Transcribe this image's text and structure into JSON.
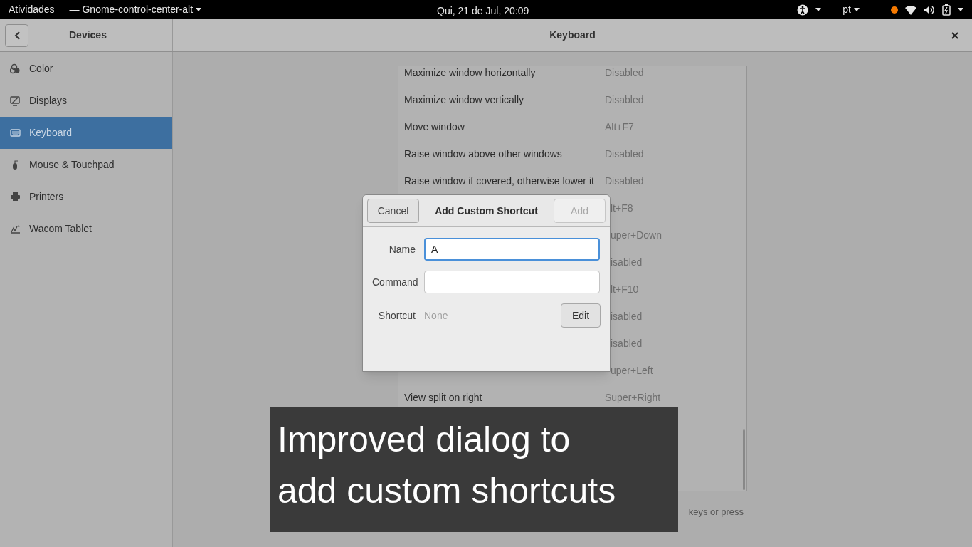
{
  "top_bar": {
    "activities": "Atividades",
    "app_menu": "— Gnome-control-center-alt",
    "clock": "Qui, 21 de Jul, 20:09",
    "language": "pt",
    "notification_dot": {
      "color": "#f57900"
    }
  },
  "sidebar": {
    "title": "Devices",
    "items": [
      {
        "label": "Color",
        "kind": "color",
        "selected": false
      },
      {
        "label": "Displays",
        "kind": "display",
        "selected": false
      },
      {
        "label": "Keyboard",
        "kind": "keyboard",
        "selected": true
      },
      {
        "label": "Mouse & Touchpad",
        "kind": "mouse",
        "selected": false
      },
      {
        "label": "Printers",
        "kind": "printer",
        "selected": false
      },
      {
        "label": "Wacom Tablet",
        "kind": "tablet",
        "selected": false
      }
    ]
  },
  "panel": {
    "title": "Keyboard",
    "shortcuts": [
      {
        "name": "Maximize window horizontally",
        "shortcut": "Disabled"
      },
      {
        "name": "Maximize window vertically",
        "shortcut": "Disabled"
      },
      {
        "name": "Move window",
        "shortcut": "Alt+F7"
      },
      {
        "name": "Raise window above other windows",
        "shortcut": "Disabled"
      },
      {
        "name": "Raise window if covered, otherwise lower it",
        "shortcut": "Disabled"
      },
      {
        "shortcut": "lt+F8"
      },
      {
        "shortcut": "uper+Down"
      },
      {
        "shortcut": "isabled"
      },
      {
        "shortcut": "lt+F10"
      },
      {
        "shortcut": "isabled"
      },
      {
        "shortcut": "isabled"
      },
      {
        "shortcut": "uper+Left"
      },
      {
        "name": "View split on right",
        "shortcut": "Super+Right"
      }
    ],
    "hint": "keys or press"
  },
  "dialog": {
    "title": "Add Custom Shortcut",
    "cancel": "Cancel",
    "add": {
      "label": "Add",
      "disabled": true
    },
    "name": {
      "label": "Name",
      "value": "A",
      "focused": true
    },
    "command": {
      "label": "Command",
      "focused": false
    },
    "shortcut": {
      "label": "Shortcut",
      "value": "None",
      "edit": "Edit"
    }
  },
  "caption": {
    "lines": [
      "Improved dialog to",
      "add custom shortcuts"
    ]
  }
}
